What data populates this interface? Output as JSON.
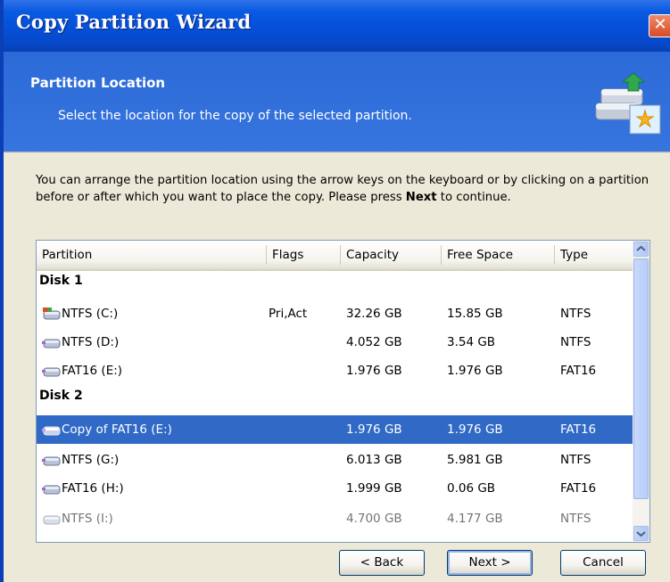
{
  "window": {
    "title": "Copy Partition Wizard",
    "close_label": "✕"
  },
  "header": {
    "title": "Partition Location",
    "subtitle": "Select the location for the copy of the selected partition.",
    "icon": "disk-copy-wizard-icon"
  },
  "instructions": {
    "text_before": "You can arrange the partition location using the arrow keys on the keyboard or by clicking on a partition before or after which you want to place the copy. Please press ",
    "bold_word": "Next",
    "text_after": " to continue."
  },
  "list": {
    "columns": [
      "Partition",
      "Flags",
      "Capacity",
      "Free Space",
      "Type"
    ],
    "groups": [
      {
        "label": "Disk 1",
        "rows": [
          {
            "name": "NTFS (C:)",
            "flags": "Pri,Act",
            "capacity": "32.26 GB",
            "free": "15.85 GB",
            "type": "NTFS",
            "icon": "system-partition-icon"
          },
          {
            "name": "NTFS (D:)",
            "flags": "",
            "capacity": "4.052 GB",
            "free": "3.54 GB",
            "type": "NTFS",
            "icon": "partition-icon"
          },
          {
            "name": "FAT16 (E:)",
            "flags": "",
            "capacity": "1.976 GB",
            "free": "1.976 GB",
            "type": "FAT16",
            "icon": "partition-icon"
          }
        ]
      },
      {
        "label": "Disk 2",
        "rows": [
          {
            "name": "Copy of FAT16 (E:)",
            "flags": "",
            "capacity": "1.976 GB",
            "free": "1.976 GB",
            "type": "FAT16",
            "icon": "partition-copy-icon",
            "selected": true
          },
          {
            "name": "NTFS (G:)",
            "flags": "",
            "capacity": "6.013 GB",
            "free": "5.981 GB",
            "type": "NTFS",
            "icon": "partition-icon"
          },
          {
            "name": "FAT16 (H:)",
            "flags": "",
            "capacity": "1.999 GB",
            "free": "0.06 GB",
            "type": "FAT16",
            "icon": "partition-icon"
          },
          {
            "name": "NTFS (I:)",
            "flags": "",
            "capacity": "4.700 GB",
            "free": "4.177 GB",
            "type": "NTFS",
            "icon": "partition-icon",
            "partially_visible": true
          }
        ]
      }
    ]
  },
  "buttons": {
    "back": "< Back",
    "next": "Next >",
    "cancel": "Cancel"
  },
  "colors": {
    "selection": "#3169c6",
    "title_bar": "#0550d8",
    "header_panel": "#3674de"
  }
}
